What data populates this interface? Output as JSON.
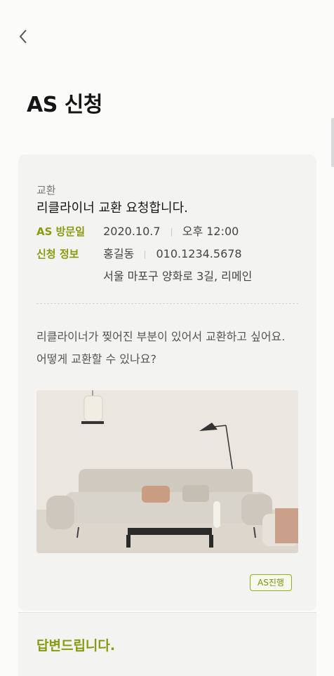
{
  "header": {
    "title": "AS 신청",
    "back_icon": "chevron-left-icon"
  },
  "request": {
    "category": "교환",
    "title": "리클라이너 교환 요청합니다.",
    "visit": {
      "label": "AS 방문일",
      "date": "2020.10.7",
      "time": "오후 12:00"
    },
    "applicant": {
      "label": "신청 정보",
      "name": "홍길동",
      "phone": "010.1234.5678",
      "address": "서울 마포구 양화로 3길, 리메인"
    },
    "body": "리클라이너가 찢어진 부분이 있어서 교환하고 싶어요. 어떻게 교환할 수 있나요?",
    "photo": "sofa-photo",
    "status_badge": "AS진행"
  },
  "answer": {
    "title": "답변드립니다."
  },
  "colors": {
    "accent": "#8a9a0f",
    "card_bg": "#f3f3f2",
    "page_bg": "#fbfbfa"
  }
}
